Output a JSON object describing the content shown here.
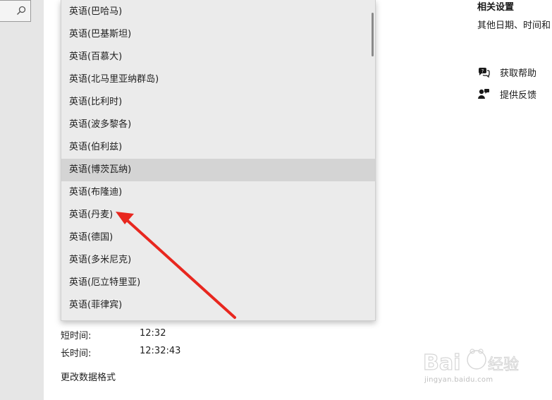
{
  "dropdown": {
    "items": [
      {
        "label": "英语(巴哈马)",
        "selected": false
      },
      {
        "label": "英语(巴基斯坦)",
        "selected": false
      },
      {
        "label": "英语(百慕大)",
        "selected": false
      },
      {
        "label": "英语(北马里亚纳群岛)",
        "selected": false
      },
      {
        "label": "英语(比利时)",
        "selected": false
      },
      {
        "label": "英语(波多黎各)",
        "selected": false
      },
      {
        "label": "英语(伯利兹)",
        "selected": false
      },
      {
        "label": "英语(博茨瓦纳)",
        "selected": true
      },
      {
        "label": "英语(布隆迪)",
        "selected": false
      },
      {
        "label": "英语(丹麦)",
        "selected": false
      },
      {
        "label": "英语(德国)",
        "selected": false
      },
      {
        "label": "英语(多米尼克)",
        "selected": false
      },
      {
        "label": "英语(厄立特里亚)",
        "selected": false
      },
      {
        "label": "英语(菲律宾)",
        "selected": false
      }
    ]
  },
  "time_formats": {
    "short_label": "短时间:",
    "short_value": "12:32",
    "long_label": "长时间:",
    "long_value": "12:32:43"
  },
  "change_formats_link": "更改数据格式",
  "related": {
    "title": "相关设置",
    "link": "其他日期、时间和"
  },
  "help": {
    "get_help": "获取帮助",
    "feedback": "提供反馈"
  },
  "colors": {
    "arrow": "#e8271f",
    "selected_row": "#d4d4d4",
    "dropdown_bg": "#ebebeb"
  },
  "watermark": {
    "text": "jingyan.baidu.com"
  }
}
